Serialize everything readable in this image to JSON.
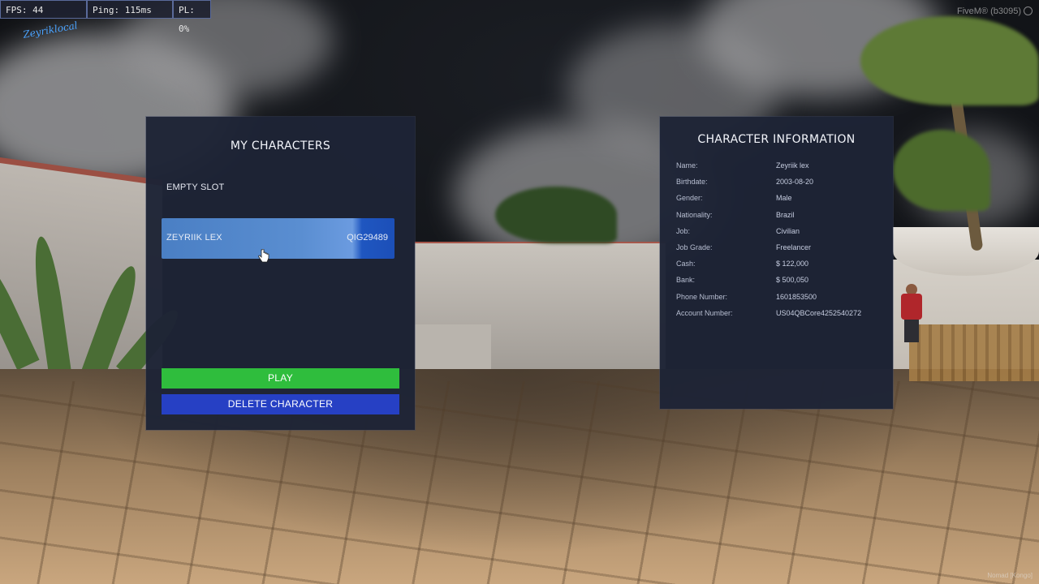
{
  "hud": {
    "fps": "FPS: 44",
    "ping": "Ping: 115ms",
    "pl": "PL: 0%",
    "logo": "Zeyriklocal",
    "fivem": "FiveM® (b3095)",
    "watermark_right": "Nomad [Kongo]"
  },
  "characters_panel": {
    "title": "MY CHARACTERS",
    "empty_slot": "EMPTY SLOT",
    "selected_slot": {
      "name": "ZEYRIIK LEX",
      "citizen_id": "QIG29489"
    },
    "play_label": "PLAY",
    "delete_label": "DELETE CHARACTER"
  },
  "info_panel": {
    "title": "CHARACTER INFORMATION",
    "rows": [
      {
        "label": "Name:",
        "value": "Zeyriik lex"
      },
      {
        "label": "Birthdate:",
        "value": "2003-08-20"
      },
      {
        "label": "Gender:",
        "value": "Male"
      },
      {
        "label": "Nationality:",
        "value": "Brazil"
      },
      {
        "label": "Job:",
        "value": "Civilian"
      },
      {
        "label": "Job Grade:",
        "value": "Freelancer"
      },
      {
        "label": "Cash:",
        "value": "$ 122,000"
      },
      {
        "label": "Bank:",
        "value": "$ 500,050"
      },
      {
        "label": "Phone Number:",
        "value": "1601853500"
      },
      {
        "label": "Account Number:",
        "value": "US04QBCore4252540272"
      }
    ]
  },
  "colors": {
    "panel_bg": "#1e2436",
    "play": "#2fbd3d",
    "delete": "#2640c4",
    "selected_slot": "#5a8ed1"
  }
}
